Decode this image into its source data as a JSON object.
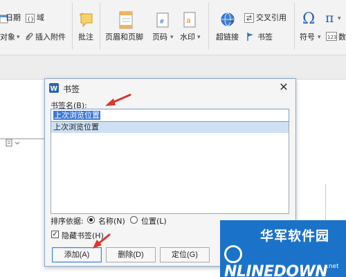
{
  "ribbon": {
    "date_label": "日期",
    "field_label": "域",
    "object_label": "对象",
    "insert_attachment_label": "插入附件",
    "comment_label": "批注",
    "header_footer_label": "页眉和页脚",
    "page_number_label": "页码",
    "watermark_label": "水印",
    "hyperlink_label": "超链接",
    "cross_reference_label": "交叉引用",
    "bookmark_label": "书签",
    "symbol_label": "符号",
    "formula_label": "数",
    "dropdown_glyph": "▾"
  },
  "dialog": {
    "title": "书签",
    "close_glyph": "✕",
    "name_label": "书签名(B):",
    "name_value": "上次浏览位置",
    "list_items": [
      "上次浏览位置"
    ],
    "sort_label": "排序依据:",
    "sort_by_name": "名称(N)",
    "sort_by_location": "位置(L)",
    "hidden_bookmarks": "隐藏书签(H)",
    "add_button": "添加(A)",
    "delete_button": "删除(D)",
    "goto_button": "定位(G)",
    "check_glyph": "✓"
  },
  "watermark": {
    "chinese": "华军软件园",
    "logo_rest": "NLINEDOWN",
    "net": ".net"
  },
  "colors": {
    "accent": "#3b78d8",
    "arrow": "#d9372e",
    "watermark_blue": "#1a73c9"
  }
}
